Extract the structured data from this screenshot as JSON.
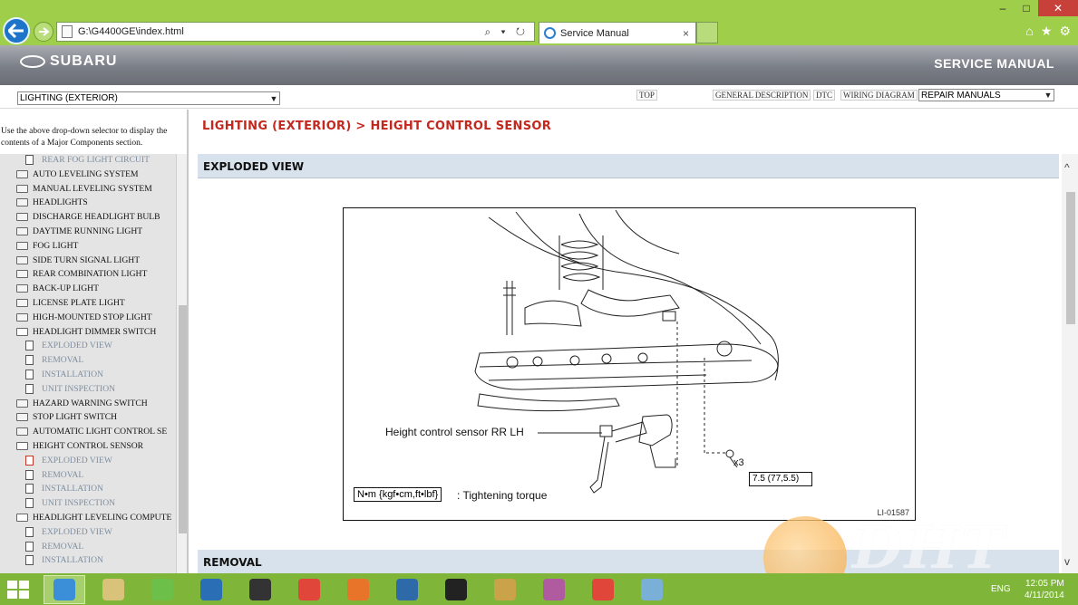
{
  "browser": {
    "address": "G:\\G4400GE\\index.html",
    "address_controls": "⌕ ▾ ↻",
    "tab_title": "Service Manual",
    "tab_close": "×",
    "window_controls": [
      "–",
      "□",
      "✕"
    ],
    "toolbar_icons": [
      "⌂",
      "★",
      "⚙"
    ]
  },
  "header": {
    "brand": "SUBARU",
    "product": "SERVICE MANUAL"
  },
  "toolbar": {
    "section_select_value": "LIGHTING (EXTERIOR)",
    "links": [
      "TOP",
      "GENERAL DESCRIPTION",
      "DTC",
      "WIRING DIAGRAM"
    ],
    "manual_select_value": "REPAIR MANUALS"
  },
  "sidebar": {
    "help_text": "Use the above drop-down selector to display the contents of a Major Components section.",
    "items": [
      {
        "label": "REAR FOG LIGHT CIRCUIT",
        "kind": "doc"
      },
      {
        "label": "AUTO LEVELING SYSTEM",
        "kind": "folder"
      },
      {
        "label": "MANUAL LEVELING SYSTEM",
        "kind": "folder"
      },
      {
        "label": "HEADLIGHTS",
        "kind": "folder"
      },
      {
        "label": "DISCHARGE HEADLIGHT BULB",
        "kind": "folder"
      },
      {
        "label": "DAYTIME RUNNING LIGHT",
        "kind": "folder"
      },
      {
        "label": "FOG LIGHT",
        "kind": "folder"
      },
      {
        "label": "SIDE TURN SIGNAL LIGHT",
        "kind": "folder"
      },
      {
        "label": "REAR COMBINATION LIGHT",
        "kind": "folder"
      },
      {
        "label": "BACK-UP LIGHT",
        "kind": "folder"
      },
      {
        "label": "LICENSE PLATE LIGHT",
        "kind": "folder"
      },
      {
        "label": "HIGH-MOUNTED STOP LIGHT",
        "kind": "folder"
      },
      {
        "label": "HEADLIGHT DIMMER SWITCH",
        "kind": "open"
      },
      {
        "label": "EXPLODED VIEW",
        "kind": "doc"
      },
      {
        "label": "REMOVAL",
        "kind": "doc"
      },
      {
        "label": "INSTALLATION",
        "kind": "doc"
      },
      {
        "label": "UNIT INSPECTION",
        "kind": "doc"
      },
      {
        "label": "HAZARD WARNING SWITCH",
        "kind": "folder"
      },
      {
        "label": "STOP LIGHT SWITCH",
        "kind": "folder"
      },
      {
        "label": "AUTOMATIC LIGHT CONTROL SE",
        "kind": "folder"
      },
      {
        "label": "HEIGHT CONTROL SENSOR",
        "kind": "open"
      },
      {
        "label": "EXPLODED VIEW",
        "kind": "doc-active"
      },
      {
        "label": "REMOVAL",
        "kind": "doc"
      },
      {
        "label": "INSTALLATION",
        "kind": "doc"
      },
      {
        "label": "UNIT INSPECTION",
        "kind": "doc"
      },
      {
        "label": "HEADLIGHT LEVELING COMPUTE",
        "kind": "open"
      },
      {
        "label": "EXPLODED VIEW",
        "kind": "doc"
      },
      {
        "label": "REMOVAL",
        "kind": "doc"
      },
      {
        "label": "INSTALLATION",
        "kind": "doc"
      }
    ]
  },
  "content": {
    "breadcrumb": "LIGHTING (EXTERIOR) > HEIGHT CONTROL SENSOR",
    "section_exploded": "EXPLODED VIEW",
    "section_removal": "REMOVAL",
    "figure": {
      "sensor_label": "Height control sensor RR LH",
      "bolt_count": "x3",
      "torque_value": "7.5 (77,5.5)",
      "legend_units": "N•m {kgf•cm,ft•lbf}",
      "legend_text": ": Tightening torque",
      "figure_code": "LI-01587"
    }
  },
  "watermark": {
    "text": "DHT"
  },
  "taskbar": {
    "apps": [
      "internet-explorer",
      "file-explorer",
      "app-green",
      "app-blue-globe",
      "camera",
      "chrome",
      "firefox",
      "app-window",
      "check-app",
      "onion",
      "app-pinwheel",
      "chrome-2",
      "app-square"
    ],
    "language": "ENG",
    "time": "12:05 PM",
    "date": "4/11/2014"
  },
  "colors": {
    "browser_chrome": "#9fce4a",
    "taskbar": "#7fb63a",
    "breadcrumb": "#c3281f",
    "section_bar": "#d8e2ec"
  }
}
